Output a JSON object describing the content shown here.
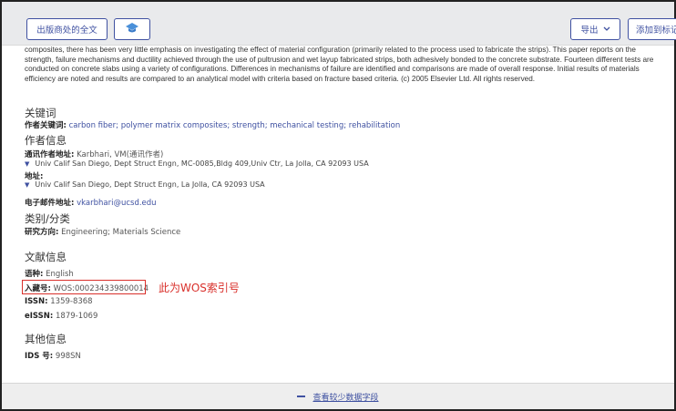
{
  "toolbar": {
    "fulltext_label": "出版商处的全文",
    "cap_icon": "graduation-cap-icon",
    "export_label": "导出",
    "add_label": "添加到标记"
  },
  "abstract": "composites, there has been very little emphasis on investigating the effect of material configuration (primarily related to the process used to fabricate the strips). This paper reports on the strength, failure mechanisms and ductility achieved through the use of pultrusion and wet layup fabricated strips, both adhesively bonded to the concrete substrate. Fourteen different tests are conducted on concrete slabs using a variety of configurations. Differences in mechanisms of failure are identified and comparisons are made of overall response. Initial results of materials efficiency are noted and results are compared to an analytical model with criteria based on fracture based criteria. (c) 2005 Elsevier Ltd. All rights reserved.",
  "keywords": {
    "title": "关键词",
    "author_keywords_label": "作者关键词:",
    "author_keywords": "carbon fiber; polymer matrix composites; strength; mechanical testing; rehabilitation"
  },
  "author_info": {
    "title": "作者信息",
    "corresponding_label": "通讯作者地址:",
    "corresponding_value": "Karbhari, VM(通讯作者)",
    "corresponding_address": "Univ Calif San Diego, Dept Struct Engn, MC-0085,Bldg 409,Univ Ctr, La Jolla, CA 92093 USA",
    "address_label": "地址:",
    "address": "Univ Calif San Diego, Dept Struct Engn, La Jolla, CA 92093 USA",
    "email_label": "电子邮件地址:",
    "email": "vkarbhari@ucsd.edu"
  },
  "category": {
    "title": "类别/分类",
    "research_label": "研究方向:",
    "research_value": "Engineering; Materials Science"
  },
  "doc_info": {
    "title": "文献信息",
    "language_label": "语种:",
    "language_value": "English",
    "accession_label": "入藏号:",
    "accession_value": "WOS:000234339800014",
    "annotation": "此为WOS索引号",
    "issn_label": "ISSN:",
    "issn_value": "1359-8368",
    "eissn_label": "eISSN:",
    "eissn_value": "1879-1069"
  },
  "other_info": {
    "title": "其他信息",
    "ids_label": "IDS 号:",
    "ids_value": "998SN"
  },
  "footer": {
    "less_fields_label": "查看较少数据字段"
  },
  "colors": {
    "accent": "#3f51a1",
    "annotation_red": "#d9302b",
    "toolbar_bg": "#e9eaec"
  }
}
